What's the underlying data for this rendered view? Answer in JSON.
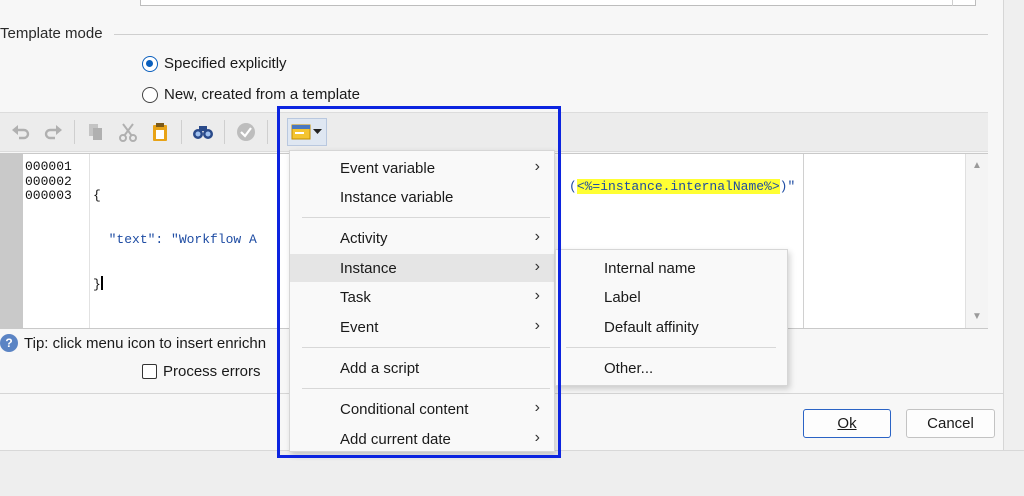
{
  "section": {
    "title": "Template mode"
  },
  "radios": [
    {
      "label": "Specified explicitly",
      "checked": true
    },
    {
      "label": "New, created from a template",
      "checked": false
    }
  ],
  "toolbar": {
    "icons": [
      "undo-icon",
      "redo-icon",
      "copy-icon",
      "cut-icon",
      "paste-icon",
      "find-icon",
      "validate-icon",
      "insert-template-icon",
      "dropdown-arrow-icon"
    ]
  },
  "editor": {
    "line_numbers": [
      "000001",
      "000002",
      "000003"
    ],
    "line1": "{",
    "line2_key": "\"text\": \"Workflow A",
    "line2_highlight": "<%=instance.internalName%>",
    "line2_tail_before": "(",
    "line2_tail_after": ")\"",
    "line3": "}"
  },
  "tip": {
    "text": "Tip: click menu icon to insert enrichn"
  },
  "process_errors": {
    "label": "Process errors",
    "checked": false
  },
  "buttons": {
    "ok": "Ok",
    "cancel": "Cancel"
  },
  "menu": {
    "items": [
      {
        "label": "Event variable",
        "submenu": true
      },
      {
        "label": "Instance variable",
        "submenu": false
      },
      {
        "label": "Activity",
        "submenu": true
      },
      {
        "label": "Instance",
        "submenu": true,
        "active": true
      },
      {
        "label": "Task",
        "submenu": true
      },
      {
        "label": "Event",
        "submenu": true
      },
      {
        "label": "Add a script",
        "submenu": false
      },
      {
        "label": "Conditional content",
        "submenu": true
      },
      {
        "label": "Add current date",
        "submenu": true
      }
    ]
  },
  "submenu": {
    "items": [
      "Internal name",
      "Label",
      "Default affinity",
      "Other..."
    ]
  },
  "colors": {
    "accent": "#0a5fbd",
    "highlight_box": "#0c24e0",
    "code_string": "#1e4ca3",
    "code_highlight": "#ffff33"
  }
}
